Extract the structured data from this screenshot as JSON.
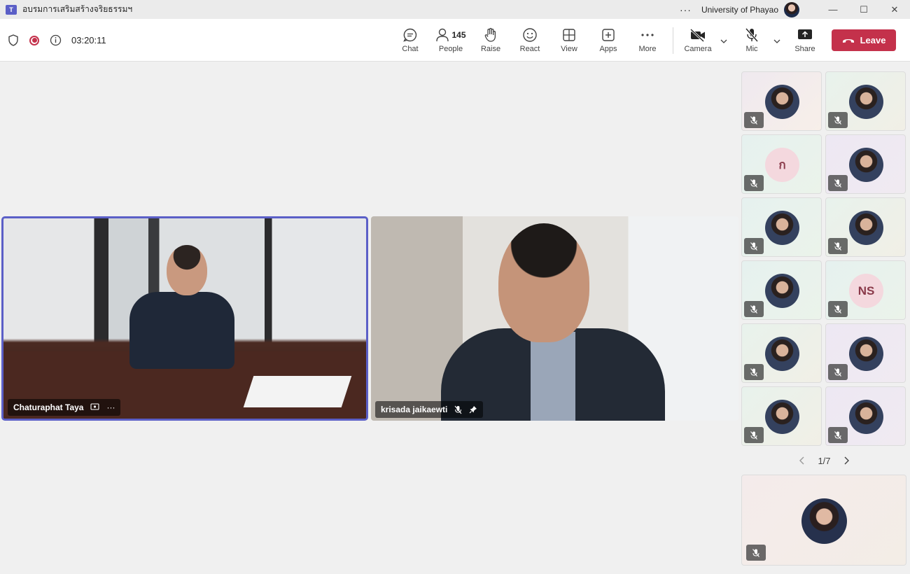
{
  "window": {
    "title": "อบรมการเสริมสร้างจริยธรรมฯ",
    "app_icon": "T",
    "more": "···",
    "org": "University of Phayao",
    "controls": {
      "minimize": "—",
      "maximize": "☐",
      "close": "✕"
    }
  },
  "toolbar": {
    "timer": "03:20:11",
    "chat": "Chat",
    "people": "People",
    "people_count": "145",
    "raise": "Raise",
    "react": "React",
    "view": "View",
    "apps": "Apps",
    "more": "More",
    "camera": "Camera",
    "mic": "Mic",
    "share": "Share",
    "leave": "Leave",
    "leave_color": "#c4314b",
    "accent_color": "#5b5fc7"
  },
  "videos": [
    {
      "name": "Chaturaphat Taya",
      "more": "···"
    },
    {
      "name": "krisada jaikaewti"
    }
  ],
  "gallery": {
    "tiles": [
      {
        "type": "photo"
      },
      {
        "type": "photo"
      },
      {
        "type": "initials",
        "initials": "ก"
      },
      {
        "type": "photo"
      },
      {
        "type": "photo"
      },
      {
        "type": "photo"
      },
      {
        "type": "photo"
      },
      {
        "type": "initials",
        "initials": "NS"
      },
      {
        "type": "photo"
      },
      {
        "type": "photo"
      },
      {
        "type": "photo"
      },
      {
        "type": "photo"
      }
    ],
    "pager": "1/7"
  }
}
